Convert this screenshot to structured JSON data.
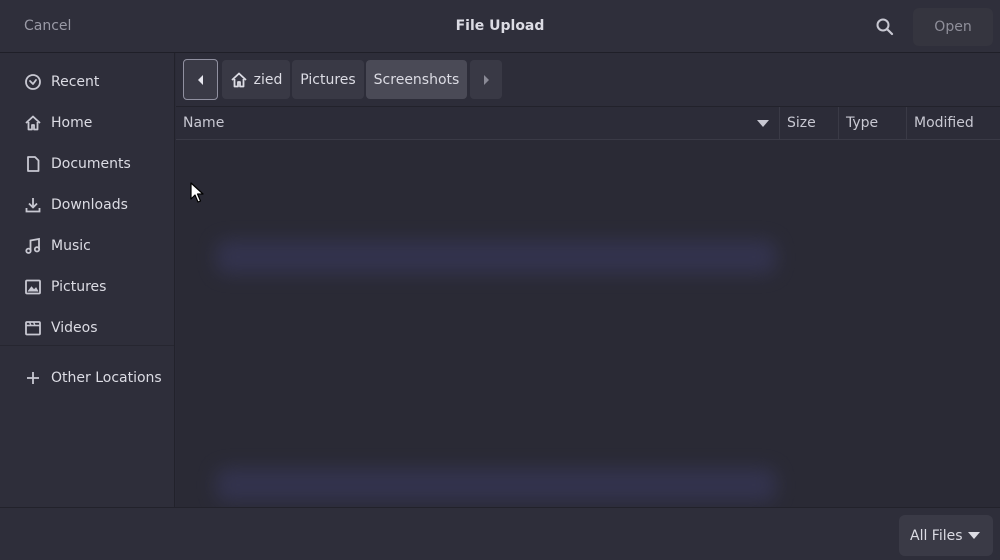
{
  "header": {
    "cancel_label": "Cancel",
    "title": "File Upload",
    "search_icon": "search-icon",
    "open_label": "Open"
  },
  "sidebar": {
    "items": [
      {
        "label": "Recent",
        "icon": "clock-icon"
      },
      {
        "label": "Home",
        "icon": "home-icon"
      },
      {
        "label": "Documents",
        "icon": "document-icon"
      },
      {
        "label": "Downloads",
        "icon": "download-icon"
      },
      {
        "label": "Music",
        "icon": "music-note-icon"
      },
      {
        "label": "Pictures",
        "icon": "image-icon"
      },
      {
        "label": "Videos",
        "icon": "video-icon"
      },
      {
        "label": "Other Locations",
        "icon": "plus-icon"
      }
    ]
  },
  "pathbar": {
    "crumbs": [
      {
        "label": "zied",
        "icon": "home-icon"
      },
      {
        "label": "Pictures"
      },
      {
        "label": "Screenshots",
        "active": true
      }
    ]
  },
  "columns": {
    "name": "Name",
    "size": "Size",
    "type": "Type",
    "modified": "Modified"
  },
  "footer": {
    "filter_label": "All Files"
  },
  "colors": {
    "background": "#2b2b37",
    "text": "#dcdce4",
    "muted_text": "#9a9aa6"
  }
}
